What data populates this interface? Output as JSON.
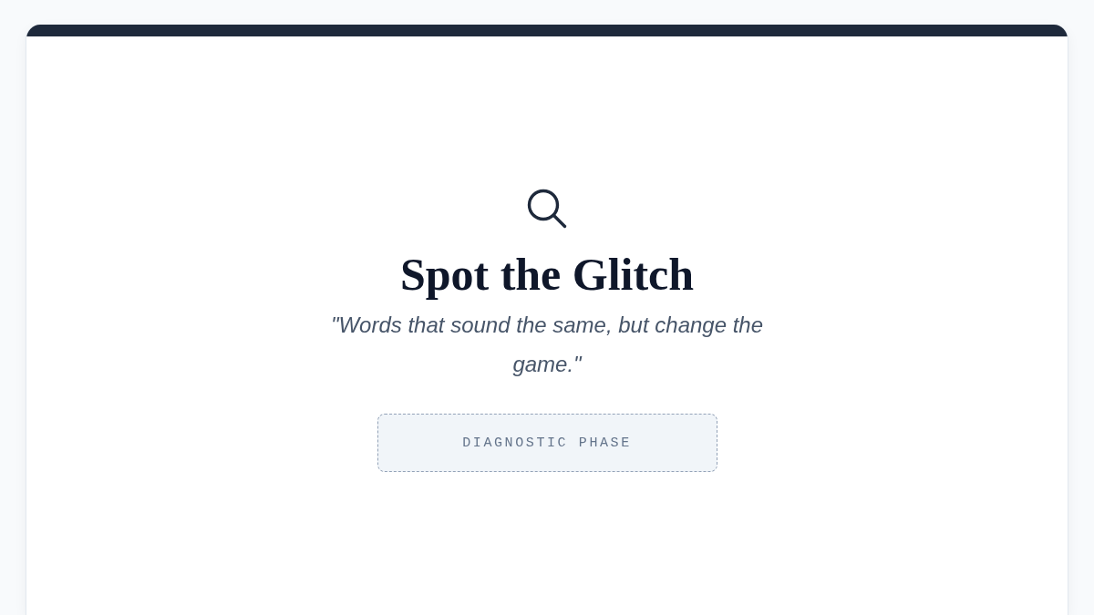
{
  "card": {
    "title": "Spot the Glitch",
    "subtitle": "\"Words that sound the same, but change the game.\"",
    "phase": "DIAGNOSTIC PHASE"
  }
}
